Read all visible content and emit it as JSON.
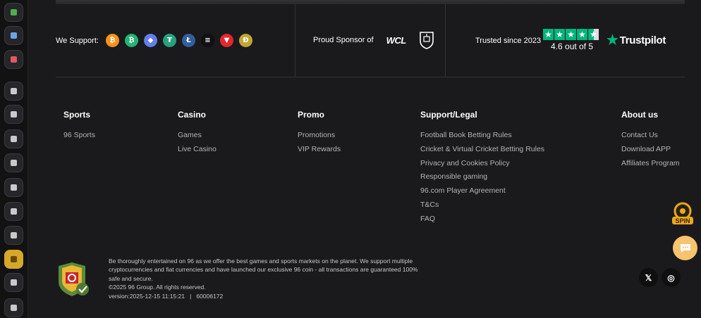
{
  "rail": {
    "icons": [
      "app-green-icon",
      "app-blue-icon",
      "app-red-icon",
      "casino-chip-icon",
      "rocket-icon",
      "seven-icon",
      "dice-icon",
      "cards-icon",
      "football-icon",
      "slots-icon",
      "crown-icon",
      "trophy-icon",
      "fire-icon"
    ],
    "active_index": 10
  },
  "top": {
    "support_label": "We Support:",
    "coins": [
      {
        "name": "bitcoin-icon",
        "glyph": "₿",
        "color": "#f7931a"
      },
      {
        "name": "bitcoin-cash-icon",
        "glyph": "₿",
        "color": "#22b573"
      },
      {
        "name": "ethereum-icon",
        "glyph": "◆",
        "color": "#627eea"
      },
      {
        "name": "tether-icon",
        "glyph": "₮",
        "color": "#26a17b"
      },
      {
        "name": "litecoin-icon",
        "glyph": "Ł",
        "color": "#345d9d"
      },
      {
        "name": "solana-icon",
        "glyph": "≡",
        "color": "#101012"
      },
      {
        "name": "tron-icon",
        "glyph": "▼",
        "color": "#e5282e"
      },
      {
        "name": "dogecoin-icon",
        "glyph": "Ð",
        "color": "#c2a633"
      }
    ],
    "sponsor_label": "Proud Sponsor of",
    "wcl_text": "WCL",
    "trusted_label": "Trusted since 2023",
    "rating_text": "4.6 out of 5",
    "rating_value": 4.6,
    "trustpilot_label": "Trustpilot",
    "trustpilot_color": "#00b67a"
  },
  "columns": [
    {
      "title": "Sports",
      "links": [
        "96 Sports"
      ]
    },
    {
      "title": "Casino",
      "links": [
        "Games",
        "Live Casino"
      ]
    },
    {
      "title": "Promo",
      "links": [
        "Promotions",
        "VIP Rewards"
      ]
    },
    {
      "title": "Support/Legal",
      "links": [
        "Football Book Betting Rules",
        "Cricket & Virtual Cricket Betting Rules",
        "Privacy and Cookies Policy",
        "Responsible gaming",
        "96.com Player Agreement",
        "T&Cs",
        "FAQ"
      ]
    },
    {
      "title": "About us",
      "links": [
        "Contact Us",
        "Download APP",
        "Affiliates Program"
      ]
    }
  ],
  "bottom": {
    "legal_lines": [
      "Be thoroughly entertained on 96 as we offer the best games and sports markets on the planet. We support multiple",
      "cryptocurrencies and fiat currencies and have launched our exclusive 96 coin - all transactions are guaranteed 100%",
      "safe and secure.",
      "©2025 96 Group. All rights reserved.",
      "version:2025-12-15 11:15:21   |   60006172"
    ],
    "social": [
      {
        "name": "x-twitter-icon",
        "glyph": "𝕏"
      },
      {
        "name": "instagram-icon",
        "glyph": "◎"
      }
    ]
  },
  "floating": {
    "spin_label": "SPIN"
  }
}
